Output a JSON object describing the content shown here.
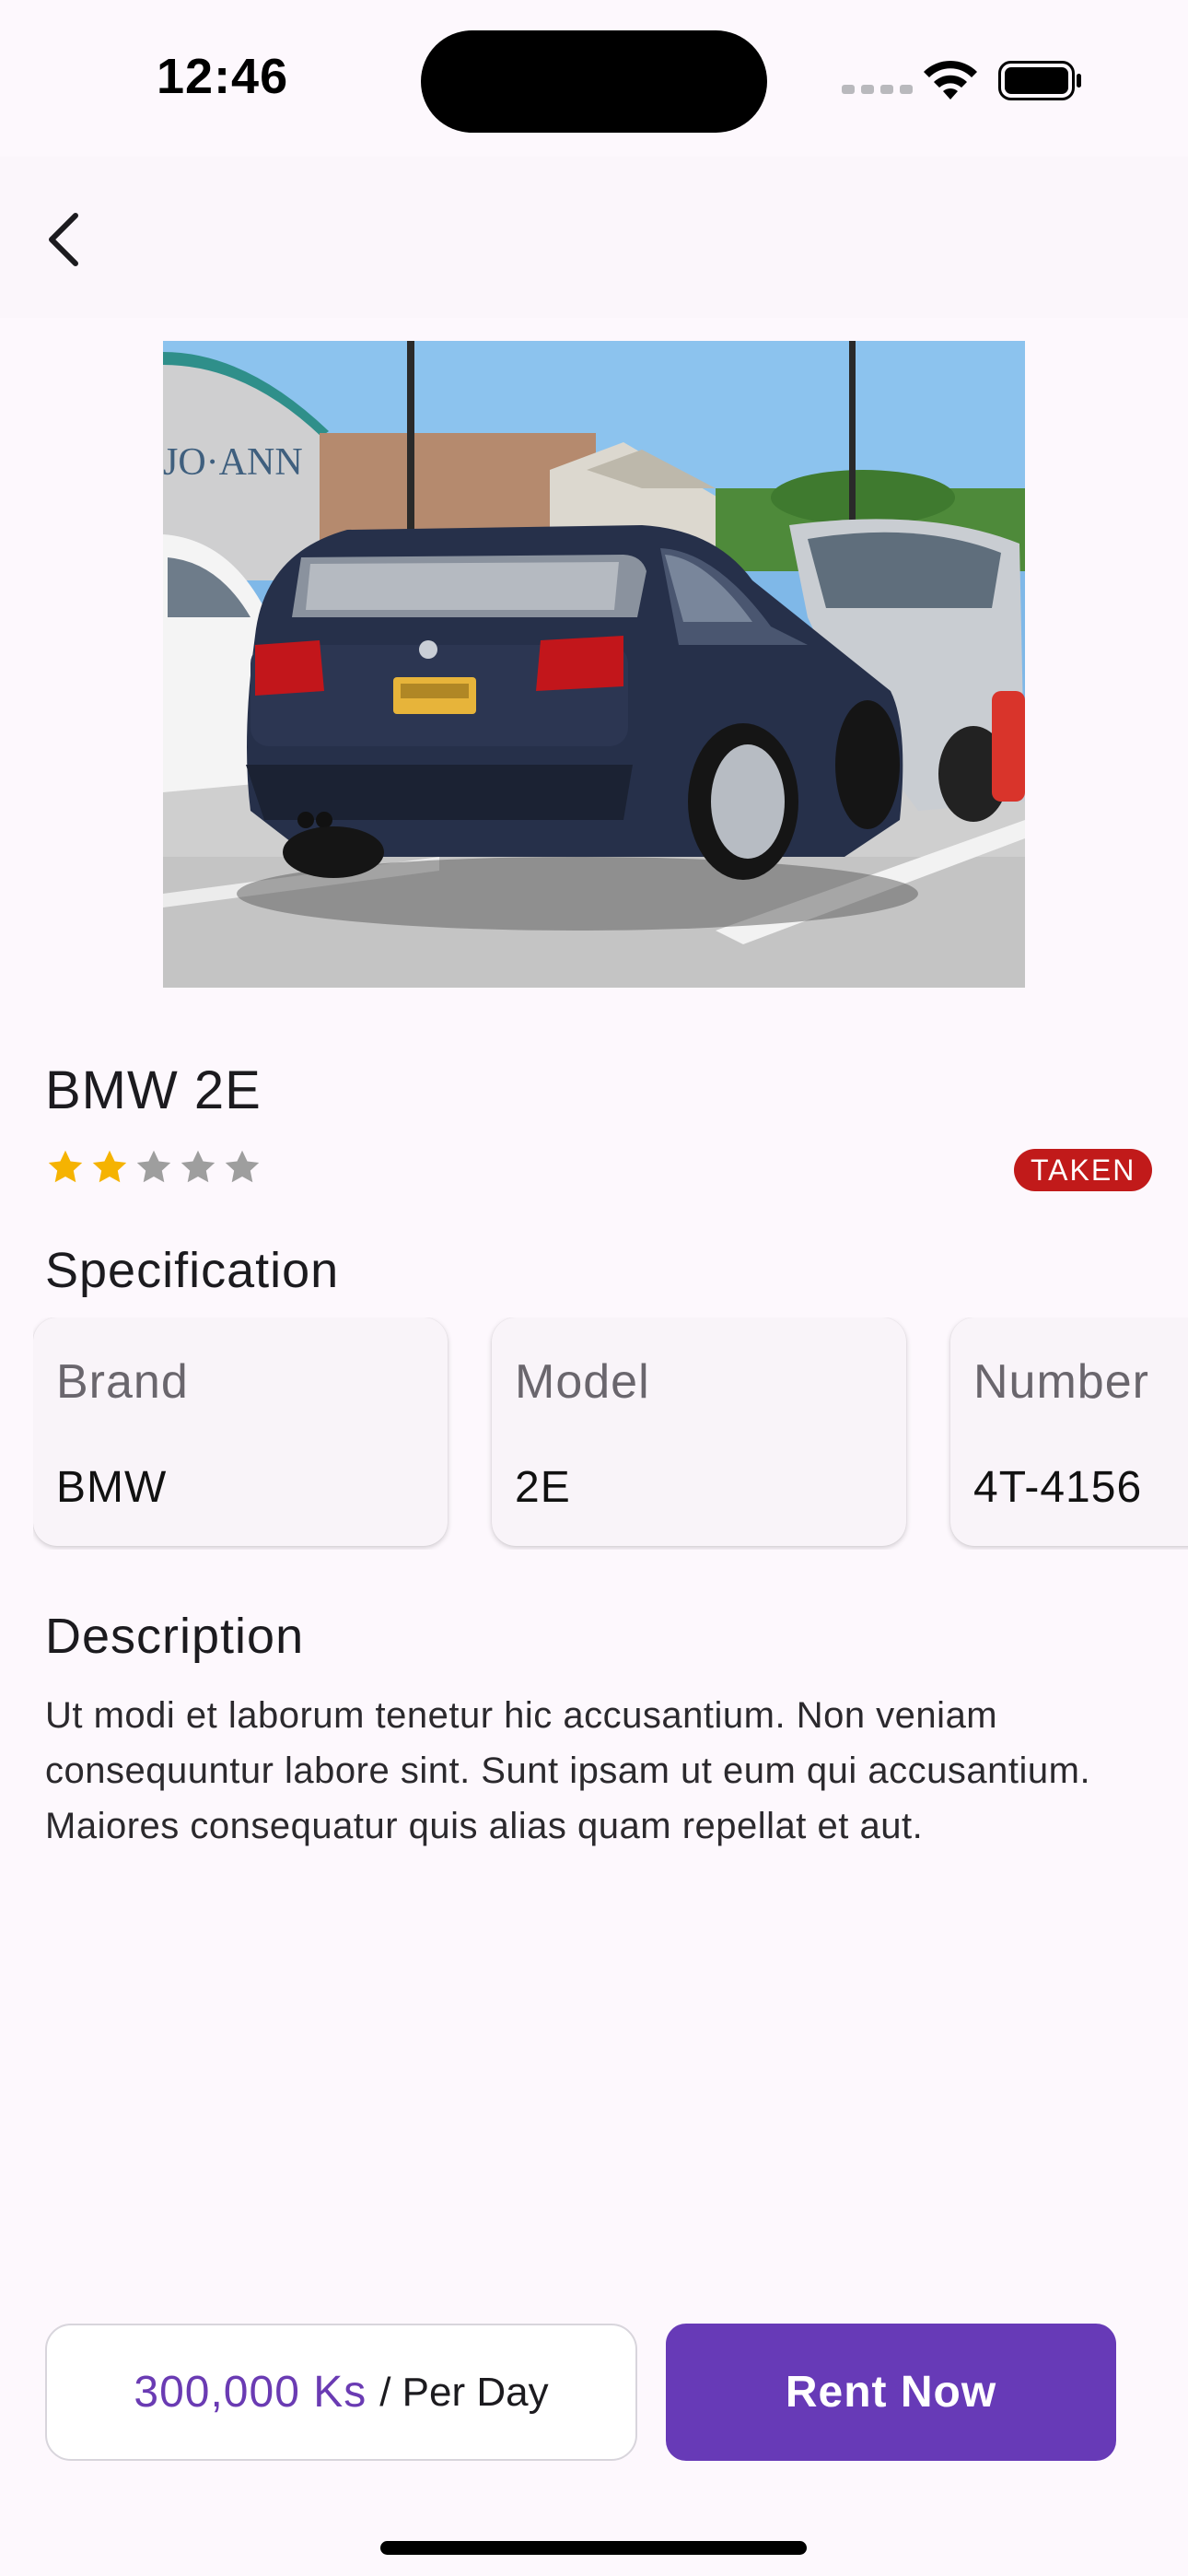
{
  "status_bar": {
    "time": "12:46"
  },
  "header": {
    "back_icon": "chevron-left-icon"
  },
  "car": {
    "image_alt": "Dark blue BMW 328i wagon parked in a lot",
    "title": "BMW 2E",
    "rating": 2,
    "rating_max": 5,
    "status": "TAKEN",
    "status_color": "#c11a1a"
  },
  "specification": {
    "title": "Specification",
    "items": [
      {
        "label": "Brand",
        "value": "BMW"
      },
      {
        "label": "Model",
        "value": "2E"
      },
      {
        "label": "Number",
        "value": "4T-4156"
      }
    ]
  },
  "description": {
    "title": "Description",
    "text": "Ut modi et laborum tenetur hic accusantium. Non veniam consequuntur labore sint. Sunt ipsam ut eum qui accusantium. Maiores consequatur quis alias quam repellat et aut."
  },
  "footer": {
    "price": "300,000 Ks",
    "price_unit": "/ Per Day",
    "rent_label": "Rent Now"
  },
  "colors": {
    "accent": "#673ab7",
    "star_on": "#f5b301",
    "star_off": "#9e9e9e",
    "background": "#fdf8fd"
  }
}
